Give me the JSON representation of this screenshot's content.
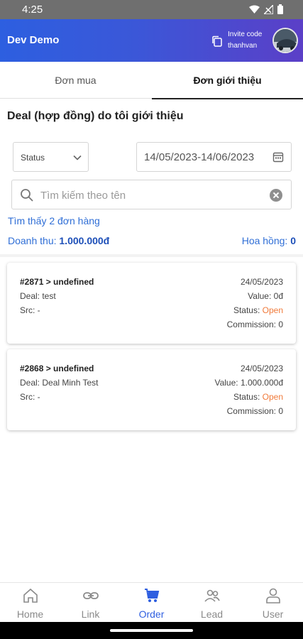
{
  "status_bar": {
    "time": "4:25"
  },
  "header": {
    "title": "Dev Demo",
    "invite_label": "Invite code",
    "invite_code": "thanhvan"
  },
  "tabs": [
    {
      "label": "Đơn mua",
      "active": false
    },
    {
      "label": "Đơn giới thiệu",
      "active": true
    }
  ],
  "section_title": "Deal (hợp đồng) do tôi giới thiệu",
  "filters": {
    "status_label": "Status",
    "date_range": "14/05/2023-14/06/2023",
    "search_placeholder": "Tìm kiếm theo tên",
    "search_value": ""
  },
  "summary": {
    "found_text": "Tìm thấy 2 đơn hàng",
    "revenue_label": "Doanh thu:",
    "revenue_value": "1.000.000đ",
    "commission_label": "Hoa hồng:",
    "commission_value": "0"
  },
  "orders": [
    {
      "code": "#2871 > undefined",
      "deal": "Deal: test",
      "src": "Src: -",
      "date": "24/05/2023",
      "value": "Value: 0đ",
      "status_label": "Status:",
      "status_value": "Open",
      "commission": "Commission: 0"
    },
    {
      "code": "#2868 > undefined",
      "deal": "Deal: Deal Minh Test",
      "src": "Src: -",
      "date": "24/05/2023",
      "value": "Value: 1.000.000đ",
      "status_label": "Status:",
      "status_value": "Open",
      "commission": "Commission: 0"
    }
  ],
  "bottom_nav": [
    {
      "label": "Home",
      "icon": "home-icon",
      "active": false
    },
    {
      "label": "Link",
      "icon": "link-icon",
      "active": false
    },
    {
      "label": "Order",
      "icon": "cart-icon",
      "active": true
    },
    {
      "label": "Lead",
      "icon": "people-icon",
      "active": false
    },
    {
      "label": "User",
      "icon": "user-icon",
      "active": false
    }
  ],
  "colors": {
    "primary": "#2f5fe0",
    "header_gradient_end": "#5b3fc7",
    "status_open": "#f07a3a",
    "link_text": "#2f6ed6"
  }
}
